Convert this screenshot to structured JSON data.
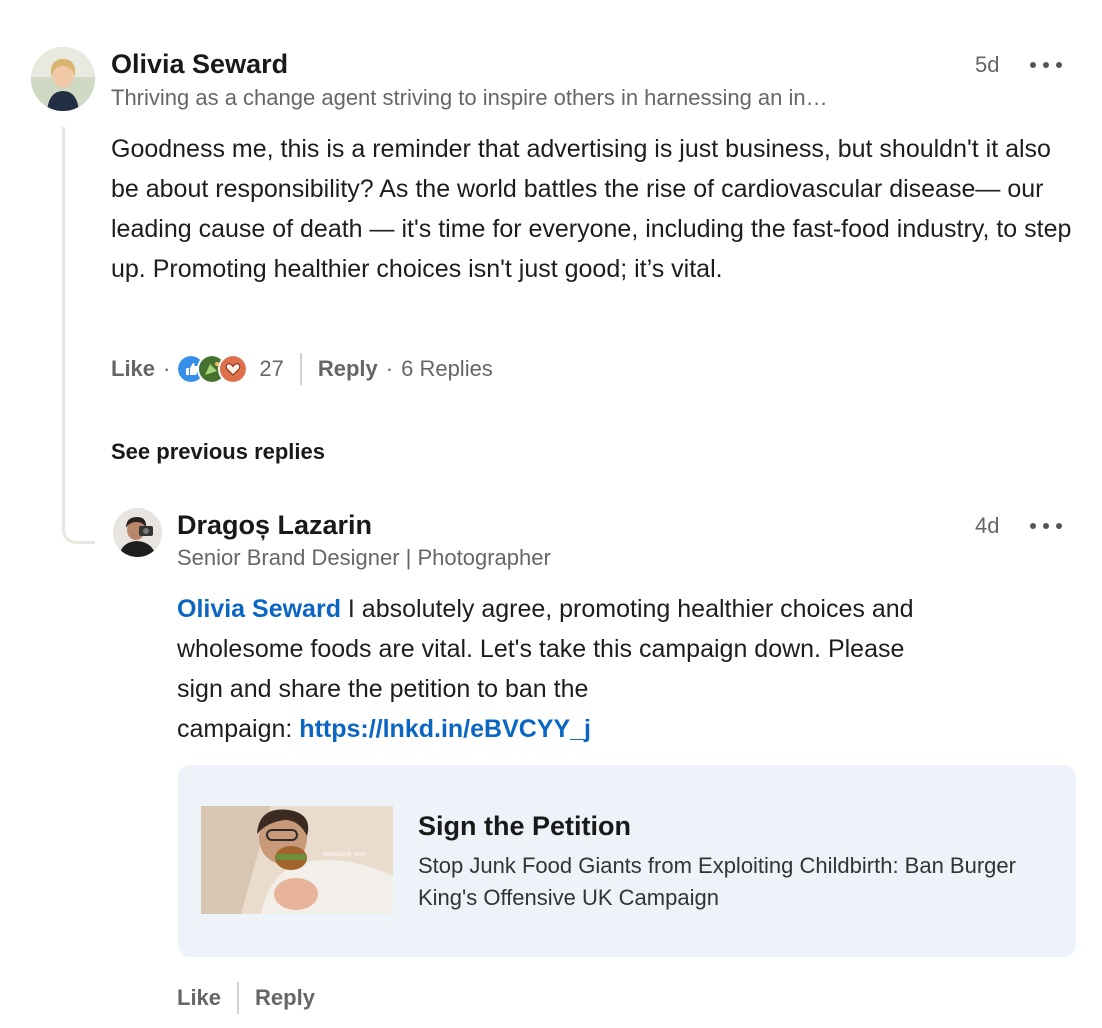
{
  "comment": {
    "author_name": "Olivia Seward",
    "author_headline": "Thriving as a change agent striving to inspire others in harnessing an in…",
    "timestamp": "5d",
    "body": "Goodness me, this is a reminder that advertising is just business, but shouldn't it also be about responsibility? As the world battles the rise of cardiovascular disease— our leading cause of death — it's time for everyone, including the fast-food industry, to step up. Promoting healthier choices isn't just good; it’s vital.",
    "like_label": "Like",
    "dot": "·",
    "reaction_count": "27",
    "reactions": [
      "like-reaction-icon",
      "celebrate-reaction-icon",
      "love-reaction-icon"
    ],
    "reply_label": "Reply",
    "dot2": "·",
    "replies_count": "6 Replies"
  },
  "see_previous_replies": "See previous replies",
  "reply": {
    "author_name": "Dragoș Lazarin",
    "author_headline": "Senior Brand Designer | Photographer",
    "timestamp": "4d",
    "mention": "Olivia Seward",
    "body_line1": " I absolutely agree, promoting healthier choices and",
    "body_line2": "wholesome foods are vital. Let's take this campaign down. Please",
    "body_line3": "sign and share the petition to ban the",
    "body_line4": "campaign: ",
    "link": "https://lnkd.in/eBVCYY_j",
    "like_label": "Like",
    "reply_label": "Reply"
  },
  "link_card": {
    "title": "Sign the Petition",
    "description": "Stop Junk Food Giants from Exploiting Childbirth: Ban Burger King's Offensive UK Campaign",
    "thumbnail_caption": "ARRIVED AT 14:07"
  },
  "colors": {
    "link": "#0a66c2",
    "card_background": "#edf3f8",
    "thread_line": "#e8e6df"
  }
}
